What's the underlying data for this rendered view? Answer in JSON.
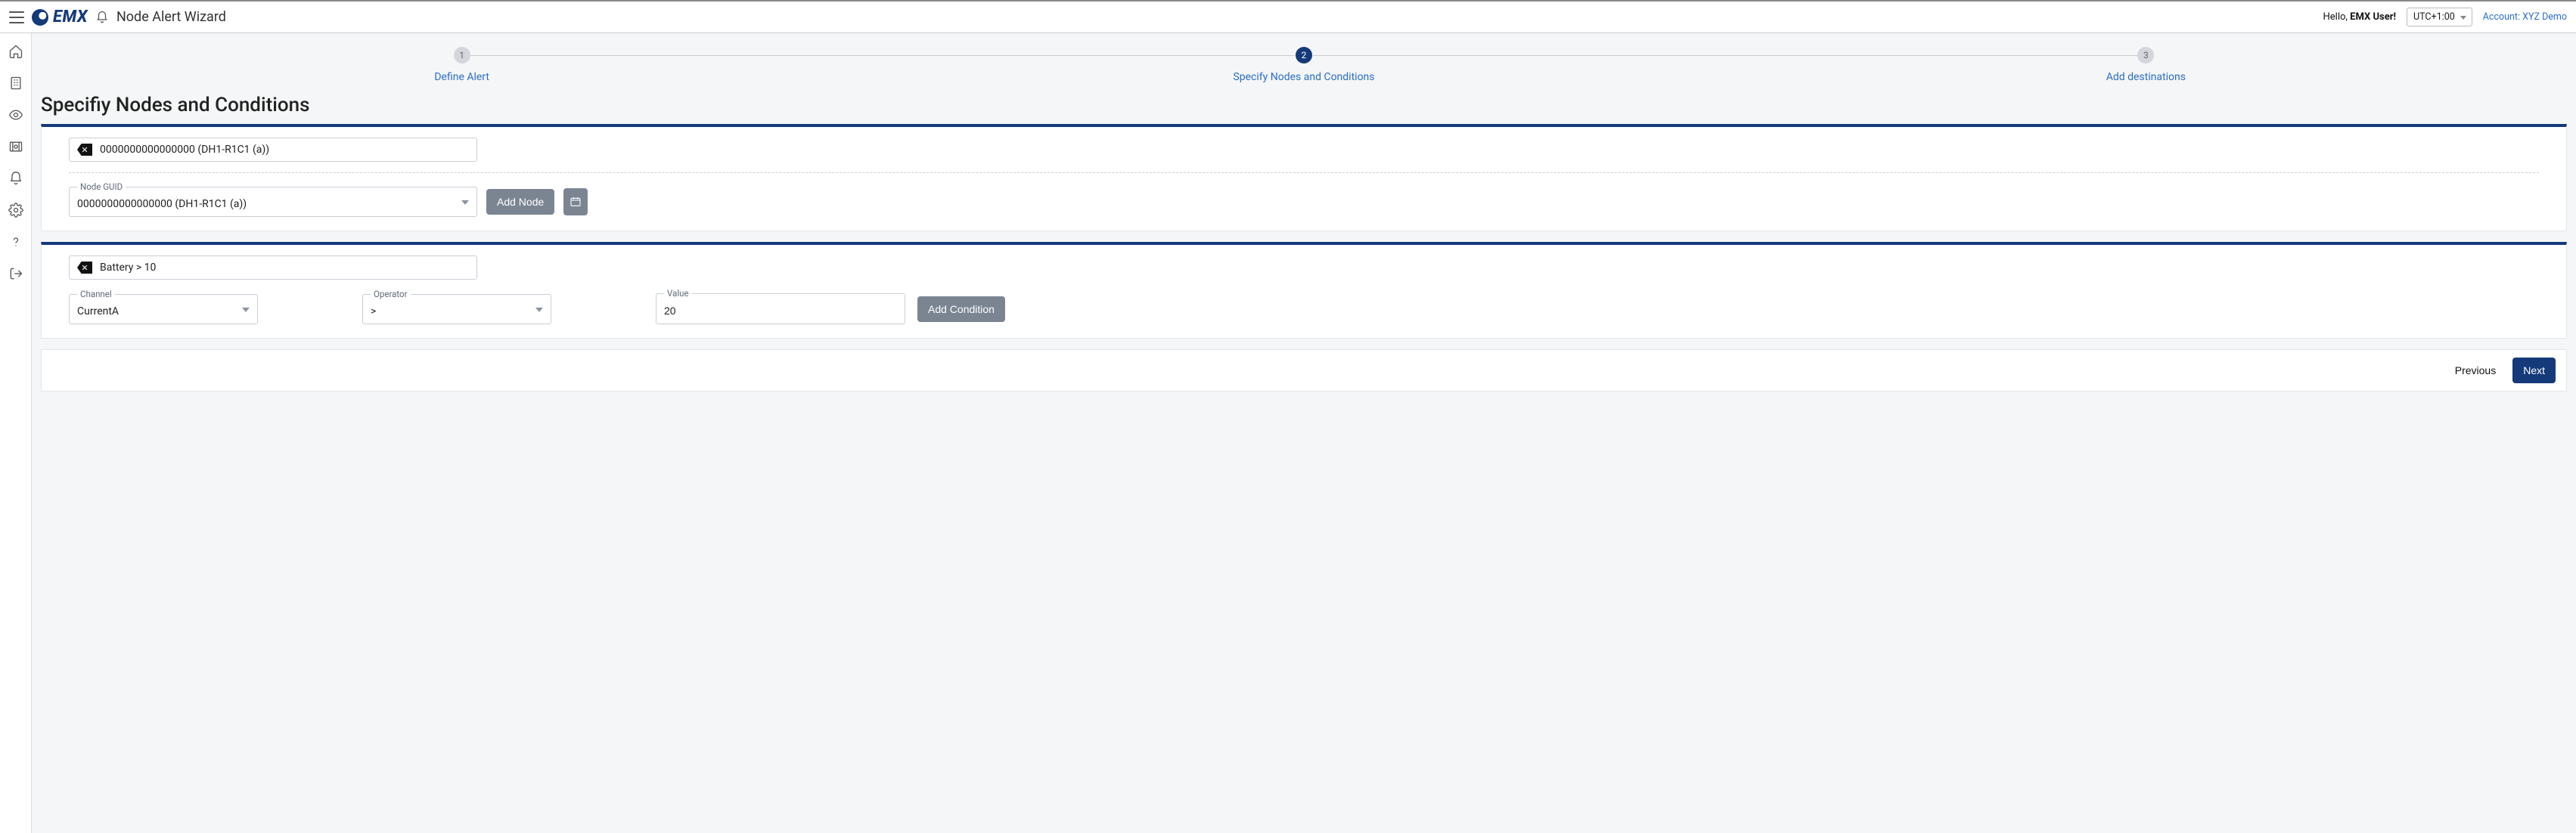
{
  "header": {
    "brand": "EMX",
    "page_title": "Node Alert Wizard",
    "hello_prefix": "Hello, ",
    "user": "EMX User!",
    "timezone": "UTC+1:00",
    "account_label": "Account: XYZ Demo"
  },
  "stepper": {
    "steps": [
      {
        "num": "1",
        "label": "Define Alert",
        "state": "inactive"
      },
      {
        "num": "2",
        "label": "Specify Nodes and Conditions",
        "state": "active"
      },
      {
        "num": "3",
        "label": "Add destinations",
        "state": "inactive"
      }
    ]
  },
  "section": {
    "heading": "Specifiy Nodes and Conditions"
  },
  "nodes": {
    "selected_chip": "0000000000000000 (DH1-R1C1 (a))",
    "guid_label": "Node GUID",
    "guid_value": "0000000000000000 (DH1-R1C1 (a))",
    "add_button": "Add Node"
  },
  "conditions": {
    "selected_chip": "Battery > 10",
    "channel_label": "Channel",
    "channel_value": "CurrentA",
    "operator_label": "Operator",
    "operator_value": ">",
    "value_label": "Value",
    "value_value": "20",
    "add_button": "Add Condition"
  },
  "footer": {
    "prev": "Previous",
    "next": "Next"
  }
}
